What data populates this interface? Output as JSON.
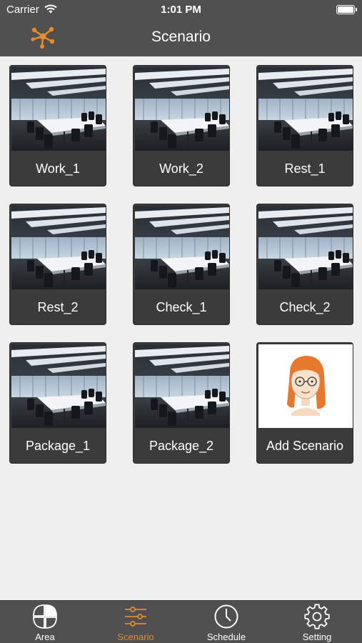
{
  "status_bar": {
    "carrier": "Carrier",
    "time": "1:01 PM"
  },
  "nav": {
    "title": "Scenario",
    "logo_icon": "network-nodes-icon"
  },
  "scenarios": [
    {
      "label": "Work_1",
      "image": "conference-room"
    },
    {
      "label": "Work_2",
      "image": "conference-room"
    },
    {
      "label": "Rest_1",
      "image": "conference-room"
    },
    {
      "label": "Rest_2",
      "image": "conference-room"
    },
    {
      "label": "Check_1",
      "image": "conference-room"
    },
    {
      "label": "Check_2",
      "image": "conference-room"
    },
    {
      "label": "Package_1",
      "image": "conference-room"
    },
    {
      "label": "Package_2",
      "image": "conference-room"
    },
    {
      "label": "Add Scenario",
      "image": "cartoon-girl-avatar"
    }
  ],
  "tabs": [
    {
      "label": "Area",
      "icon": "area-grid-icon",
      "active": false
    },
    {
      "label": "Scenario",
      "icon": "sliders-icon",
      "active": true
    },
    {
      "label": "Schedule",
      "icon": "clock-icon",
      "active": false
    },
    {
      "label": "Setting",
      "icon": "gear-icon",
      "active": false
    }
  ],
  "colors": {
    "bar": "#505050",
    "accent": "#e58a2e",
    "card": "#3b3b3b",
    "background": "#efefef"
  }
}
